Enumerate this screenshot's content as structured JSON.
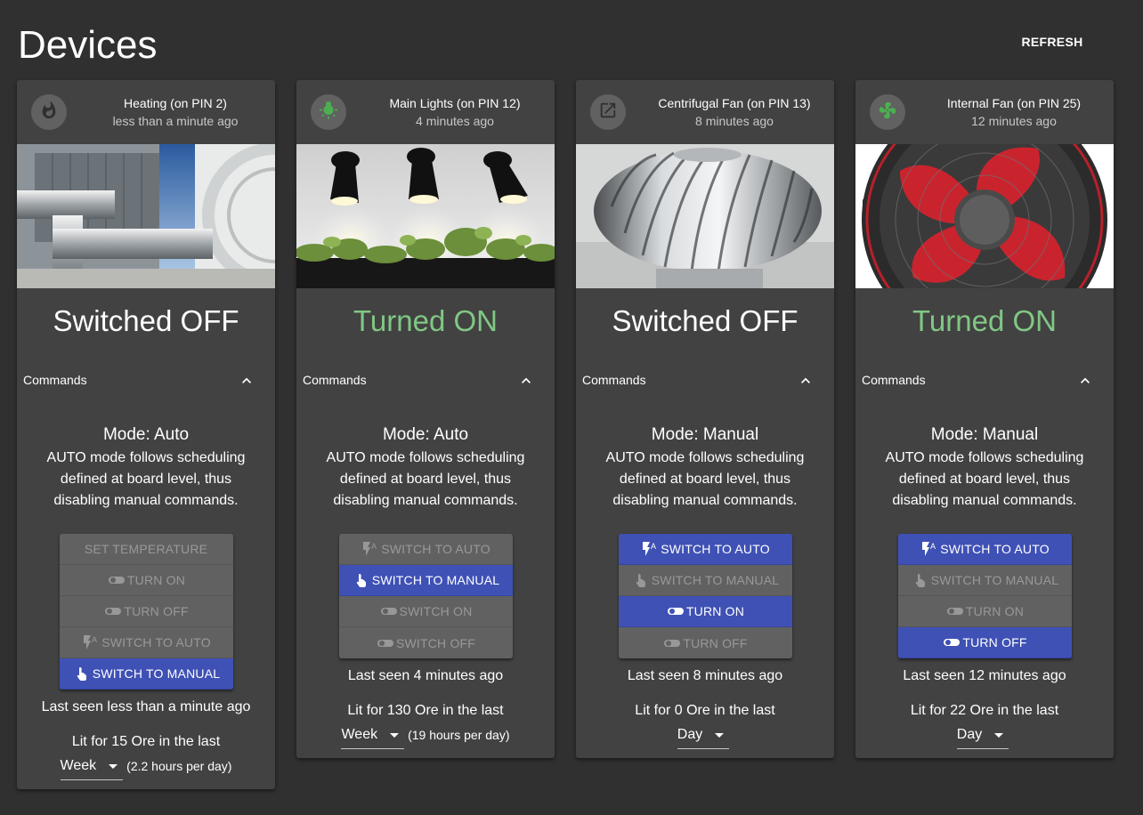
{
  "page": {
    "title": "Devices",
    "refresh_label": "REFRESH"
  },
  "colors": {
    "background": "#303030",
    "card": "#424242",
    "accent": "#3f51b5",
    "on_green": "#81c784",
    "avatar_green": "#4caf50"
  },
  "cards": [
    {
      "title": "Heating (on PIN 2)",
      "subtitle": "less than a minute ago",
      "icon": "fire-icon",
      "state": "Switched OFF",
      "commands_label": "Commands",
      "mode": "Mode: Auto",
      "description": "AUTO mode follows scheduling defined at board level, thus disabling manual commands.",
      "buttons": [
        {
          "label": "SET TEMPERATURE",
          "icon": "",
          "active": false
        },
        {
          "label": "TURN ON",
          "icon": "toggle-icon",
          "active": false
        },
        {
          "label": "TURN OFF",
          "icon": "toggle-icon",
          "active": false
        },
        {
          "label": "SWITCH TO AUTO",
          "icon": "flash-auto-icon",
          "active": false
        },
        {
          "label": "SWITCH TO MANUAL",
          "icon": "touch-icon",
          "active": true
        }
      ],
      "last_seen": "Last seen less than a minute ago",
      "lit": "Lit for 15 Ore in the last",
      "period": "Week",
      "per_day": "(2.2 hours per day)"
    },
    {
      "title": "Main Lights (on PIN 12)",
      "subtitle": "4 minutes ago",
      "icon": "lightbulb-icon",
      "state": "Turned ON",
      "commands_label": "Commands",
      "mode": "Mode: Auto",
      "description": "AUTO mode follows scheduling defined at board level, thus disabling manual commands.",
      "buttons": [
        {
          "label": "SWITCH TO AUTO",
          "icon": "flash-auto-icon",
          "active": false
        },
        {
          "label": "SWITCH TO MANUAL",
          "icon": "touch-icon",
          "active": true
        },
        {
          "label": "SWITCH ON",
          "icon": "toggle-icon",
          "active": false
        },
        {
          "label": "SWITCH OFF",
          "icon": "toggle-icon",
          "active": false
        }
      ],
      "last_seen": "Last seen 4 minutes ago",
      "lit": "Lit for 130 Ore in the last",
      "period": "Week",
      "per_day": "(19 hours per day)"
    },
    {
      "title": "Centrifugal Fan (on PIN 13)",
      "subtitle": "8 minutes ago",
      "icon": "open-in-new-icon",
      "state": "Switched OFF",
      "commands_label": "Commands",
      "mode": "Mode: Manual",
      "description": "AUTO mode follows scheduling defined at board level, thus disabling manual commands.",
      "buttons": [
        {
          "label": "SWITCH TO AUTO",
          "icon": "flash-auto-icon",
          "active": true
        },
        {
          "label": "SWITCH TO MANUAL",
          "icon": "touch-icon",
          "active": false
        },
        {
          "label": "TURN ON",
          "icon": "toggle-icon",
          "active": true
        },
        {
          "label": "TURN OFF",
          "icon": "toggle-icon",
          "active": false
        }
      ],
      "last_seen": "Last seen 8 minutes ago",
      "lit": "Lit for 0 Ore in the last",
      "period": "Day",
      "per_day": ""
    },
    {
      "title": "Internal Fan (on PIN 25)",
      "subtitle": "12 minutes ago",
      "icon": "fan-icon",
      "state": "Turned ON",
      "commands_label": "Commands",
      "mode": "Mode: Manual",
      "description": "AUTO mode follows scheduling defined at board level, thus disabling manual commands.",
      "buttons": [
        {
          "label": "SWITCH TO AUTO",
          "icon": "flash-auto-icon",
          "active": true
        },
        {
          "label": "SWITCH TO MANUAL",
          "icon": "touch-icon",
          "active": false
        },
        {
          "label": "TURN ON",
          "icon": "toggle-icon",
          "active": false
        },
        {
          "label": "TURN OFF",
          "icon": "toggle-icon",
          "active": true
        }
      ],
      "last_seen": "Last seen 12 minutes ago",
      "lit": "Lit for 22 Ore in the last",
      "period": "Day",
      "per_day": ""
    }
  ]
}
